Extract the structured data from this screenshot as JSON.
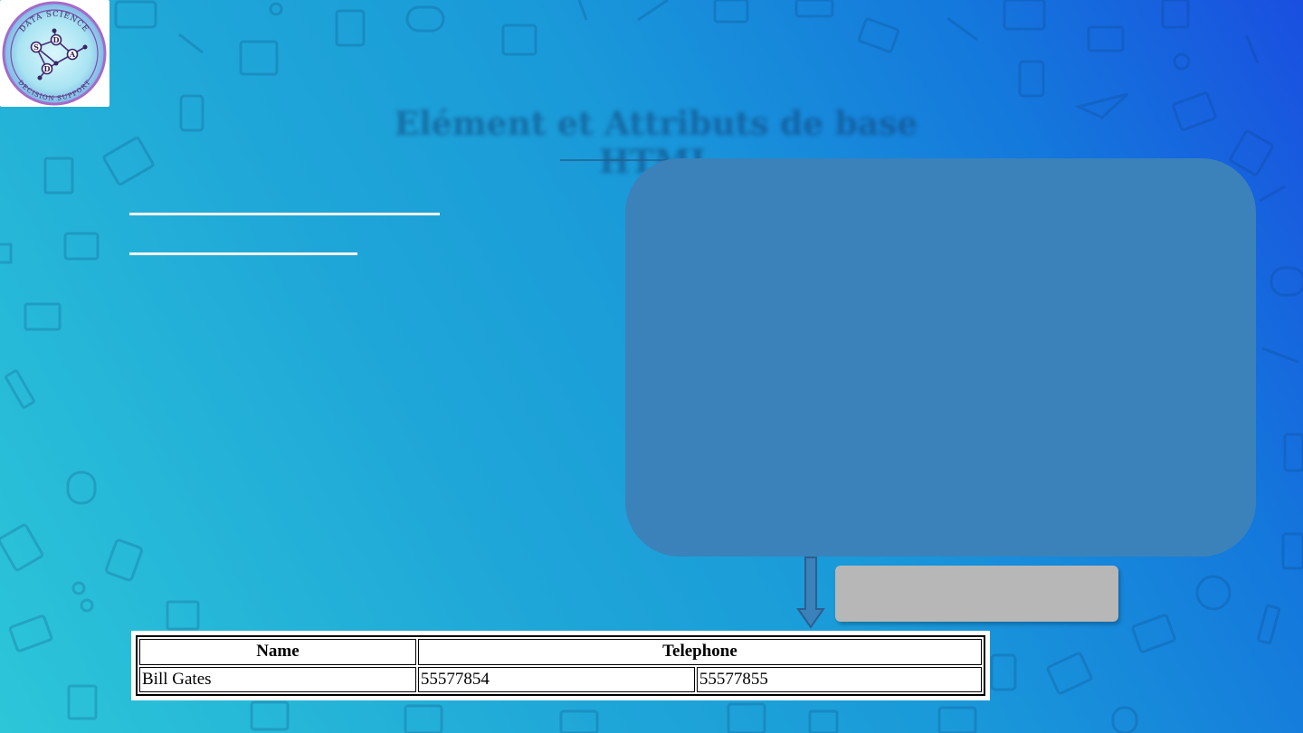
{
  "logo": {
    "top_text": "DATA SCIENCE",
    "bottom_text": "DECISION SUPPORT",
    "letters": [
      "S",
      "D",
      "D",
      "A"
    ]
  },
  "slide": {
    "title": "Elément et Attributs de base HTML"
  },
  "colors": {
    "panel": "#3b82bb",
    "result_box": "#b7b7b7",
    "text_lines": "#ffffff"
  },
  "table": {
    "headers": [
      "Name",
      "Telephone"
    ],
    "rows": [
      [
        "Bill Gates",
        "55577854",
        "55577855"
      ]
    ]
  }
}
